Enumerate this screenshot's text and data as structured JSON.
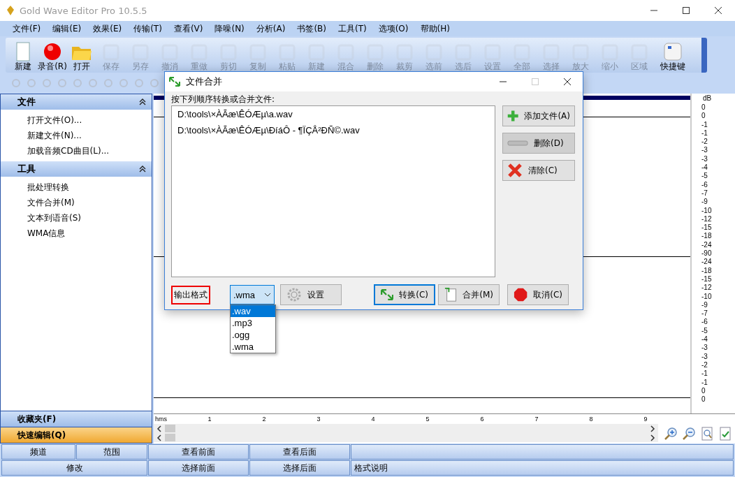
{
  "window": {
    "title": "Gold Wave Editor Pro 10.5.5"
  },
  "menu": [
    "文件(F)",
    "编辑(E)",
    "效果(E)",
    "传输(T)",
    "查看(V)",
    "降噪(N)",
    "分析(A)",
    "书签(B)",
    "工具(T)",
    "选项(O)",
    "帮助(H)"
  ],
  "toolbar": [
    {
      "label": "新建",
      "disabled": false
    },
    {
      "label": "录音(R)",
      "disabled": false
    },
    {
      "label": "打开",
      "disabled": false
    },
    {
      "label": "保存",
      "disabled": true
    },
    {
      "label": "另存",
      "disabled": true
    },
    {
      "label": "撤消",
      "disabled": true
    },
    {
      "label": "重做",
      "disabled": true
    },
    {
      "label": "剪切",
      "disabled": true
    },
    {
      "label": "复制",
      "disabled": true
    },
    {
      "label": "粘贴",
      "disabled": true
    },
    {
      "label": "新建",
      "disabled": true
    },
    {
      "label": "混合",
      "disabled": true
    },
    {
      "label": "删除",
      "disabled": true
    },
    {
      "label": "裁剪",
      "disabled": true
    },
    {
      "label": "选前",
      "disabled": true
    },
    {
      "label": "选后",
      "disabled": true
    },
    {
      "label": "设置",
      "disabled": true
    },
    {
      "label": "全部",
      "disabled": true
    },
    {
      "label": "选择",
      "disabled": true
    },
    {
      "label": "放大",
      "disabled": true
    },
    {
      "label": "缩小",
      "disabled": true
    },
    {
      "label": "区域",
      "disabled": true
    },
    {
      "label": "快捷键",
      "disabled": false
    }
  ],
  "side_panel": {
    "sections": [
      {
        "title": "文件",
        "expanded": true,
        "items": [
          "打开文件(O)...",
          "新建文件(N)...",
          "加载音频CD曲目(L)..."
        ]
      },
      {
        "title": "工具",
        "expanded": true,
        "items": [
          "批处理转换",
          "文件合并(M)",
          "文本到语音(S)",
          "WMA信息"
        ]
      }
    ],
    "bottom_tabs": [
      {
        "label": "收藏夹(F)",
        "selected": false
      },
      {
        "label": "快速编辑(Q)",
        "selected": true
      }
    ]
  },
  "db_scale": {
    "unit": "dB",
    "labels": [
      "0",
      "0",
      "-1",
      "-1",
      "-2",
      "-3",
      "-3",
      "-4",
      "-5",
      "-6",
      "-7",
      "-9",
      "-10",
      "-12",
      "-15",
      "-18",
      "-24",
      "-90",
      "-24",
      "-18",
      "-15",
      "-12",
      "-10",
      "-9",
      "-7",
      "-6",
      "-5",
      "-4",
      "-3",
      "-3",
      "-2",
      "-1",
      "-1",
      "0",
      "0"
    ]
  },
  "timeline": {
    "unit": "hms",
    "ticks": [
      "1",
      "2",
      "3",
      "4",
      "5",
      "6",
      "7",
      "8",
      "9"
    ]
  },
  "status_bar": {
    "row_1": [
      "频道",
      "范围",
      "查看前面",
      "查看后面"
    ],
    "row_2": [
      "修改",
      "选择前面",
      "选择后面",
      "格式说明"
    ]
  },
  "dialog": {
    "title": "文件合并",
    "list_label": "按下列顺序转换或合并文件:",
    "files": [
      "D:\\tools\\×ÀÃæ\\ÊÓÆµ\\a.wav",
      "D:\\tools\\×ÀÃæ\\ÊÓÆµ\\ÐíáÔ - ¶ÏÇÅ²ÐÑ©.wav"
    ],
    "side_buttons": [
      {
        "label": "添加文件(A)",
        "hovered": false
      },
      {
        "label": "删除(D)",
        "hovered": true
      },
      {
        "label": "清除(C)",
        "hovered": false
      }
    ],
    "format_label": {
      "text": "输出格式",
      "highlighted": true
    },
    "format_select": {
      "value": ".wma",
      "open": true,
      "options": [
        {
          "label": ".wav",
          "highlighted": true
        },
        {
          "label": ".mp3",
          "highlighted": false
        },
        {
          "label": ".ogg",
          "highlighted": false
        },
        {
          "label": ".wma",
          "highlighted": false
        }
      ]
    },
    "settings_button": "设置",
    "action_buttons": [
      {
        "label": "转换(C)",
        "focused": true
      },
      {
        "label": "合并(M)",
        "focused": false
      }
    ],
    "cancel_button": "取消(C)"
  }
}
